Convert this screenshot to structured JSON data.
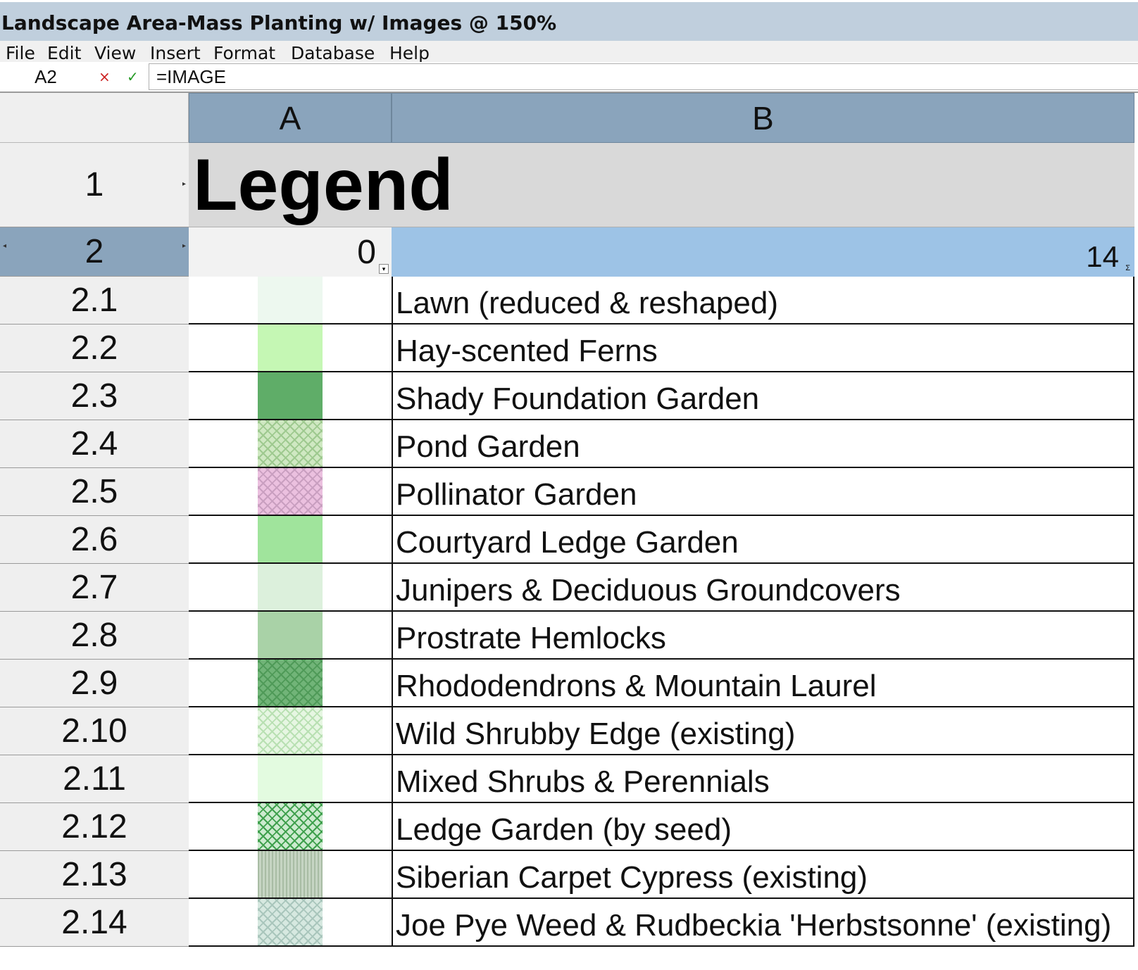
{
  "window": {
    "title": "Landscape Area-Mass Planting w/ Images @ 150%"
  },
  "menu": [
    "File",
    "Edit",
    "View",
    "Insert",
    "Format",
    "Database",
    "Help"
  ],
  "formula_bar": {
    "cell_ref": "A2",
    "cancel_icon": "×",
    "accept_icon": "✓",
    "formula": "=IMAGE"
  },
  "columns": [
    "A",
    "B"
  ],
  "row1": {
    "header": "1",
    "title": "Legend"
  },
  "row2": {
    "header": "2",
    "a_value": "0",
    "b_value": "14"
  },
  "items": [
    {
      "row": "2.1",
      "label": "Lawn (reduced & reshaped)",
      "swatch": "solid",
      "color": "#edf8ef"
    },
    {
      "row": "2.2",
      "label": "Hay-scented Ferns",
      "swatch": "solid",
      "color": "#c5f7b4"
    },
    {
      "row": "2.3",
      "label": "Shady Foundation Garden",
      "swatch": "solid",
      "color": "#5fad68"
    },
    {
      "row": "2.4",
      "label": "Pond Garden",
      "swatch": "crosshatch",
      "color": "#cfe8c2",
      "hatch_color": "#9ec98f"
    },
    {
      "row": "2.5",
      "label": "Pollinator Garden",
      "swatch": "crosshatch",
      "color": "#ebc0df",
      "hatch_color": "#c99fc0"
    },
    {
      "row": "2.6",
      "label": "Courtyard Ledge Garden",
      "swatch": "solid",
      "color": "#a0e49c"
    },
    {
      "row": "2.7",
      "label": "Junipers & Deciduous Groundcovers",
      "swatch": "solid",
      "color": "#dcf0dc"
    },
    {
      "row": "2.8",
      "label": "Prostrate Hemlocks",
      "swatch": "solid",
      "color": "#a9d2a7"
    },
    {
      "row": "2.9",
      "label": "Rhododendrons & Mountain Laurel",
      "swatch": "crosshatch",
      "color": "#71b478",
      "hatch_color": "#4f9a58"
    },
    {
      "row": "2.10",
      "label": "Wild Shrubby Edge (existing)",
      "swatch": "crosshatch",
      "color": "#e6f6e2",
      "hatch_color": "#b8e0b2"
    },
    {
      "row": "2.11",
      "label": "Mixed Shrubs & Perennials",
      "swatch": "solid",
      "color": "#e3fbe0"
    },
    {
      "row": "2.12",
      "label": "Ledge Garden (by seed)",
      "swatch": "crosshatch",
      "color": "#ccebcf",
      "hatch_color": "#3fa04d"
    },
    {
      "row": "2.13",
      "label": "Siberian Carpet Cypress (existing)",
      "swatch": "stripes",
      "color": "#c6d5c3",
      "hatch_color": "#a8bca4"
    },
    {
      "row": "2.14",
      "label": "Joe Pye Weed & Rudbeckia 'Herbstsonne' (existing)",
      "swatch": "crosshatch",
      "color": "#d6e8e0",
      "hatch_color": "#a9c6bc"
    }
  ]
}
